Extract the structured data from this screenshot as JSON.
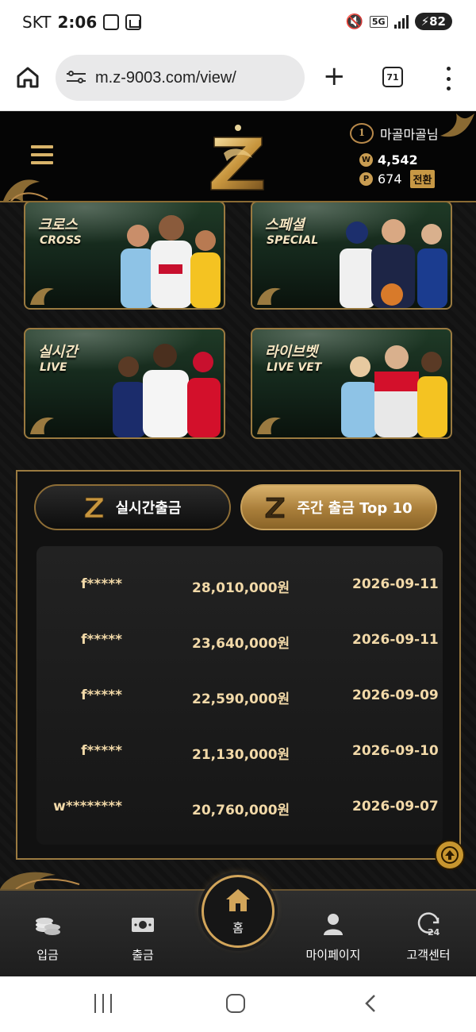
{
  "status_bar": {
    "carrier": "SKT",
    "time": "2:06",
    "network": "5G",
    "battery": "82"
  },
  "browser": {
    "url": "m.z-9003.com/view/",
    "tab_count": "71"
  },
  "header": {
    "level": "1",
    "username": "마골마골님",
    "money": "4,542",
    "points": "674",
    "money_icon": "W",
    "points_icon": "P",
    "convert_label": "전환"
  },
  "game_cards": [
    {
      "title": "크로스",
      "subtitle": "CROSS"
    },
    {
      "title": "스페셜",
      "subtitle": "SPECIAL"
    },
    {
      "title": "실시간",
      "subtitle": "LIVE"
    },
    {
      "title": "라이브벳",
      "subtitle": "LIVE VET"
    }
  ],
  "withdrawal_panel": {
    "tab_live_label": "실시간출금",
    "tab_top_label": "주간 출금 Top 10",
    "active_tab": "주간 출금 Top 10",
    "rows": [
      {
        "user": "f*****",
        "amount": "28,010,000원",
        "date": "2026-09-11"
      },
      {
        "user": "f*****",
        "amount": "23,640,000원",
        "date": "2026-09-11"
      },
      {
        "user": "f*****",
        "amount": "22,590,000원",
        "date": "2026-09-09"
      },
      {
        "user": "f*****",
        "amount": "21,130,000원",
        "date": "2026-09-10"
      },
      {
        "user": "w********",
        "amount": "20,760,000원",
        "date": "2026-09-07"
      }
    ]
  },
  "bottom_nav": {
    "deposit": "입금",
    "withdraw": "출금",
    "home": "홈",
    "mypage": "마이페이지",
    "support": "고객센터"
  },
  "colors": {
    "gold": "#d2a55a",
    "gold_text": "#f2d9a8",
    "background": "#0d0d0d"
  }
}
